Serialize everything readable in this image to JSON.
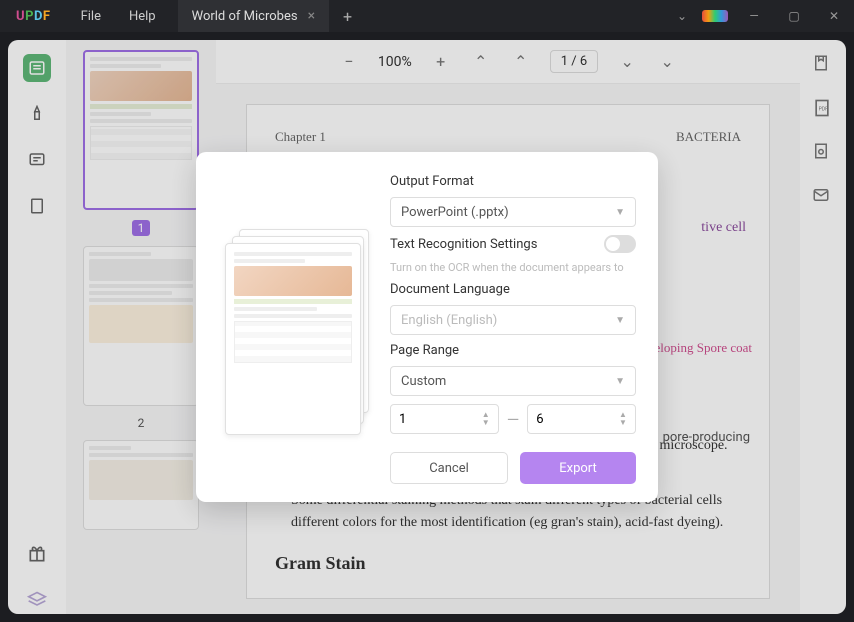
{
  "app": {
    "name": "UPDF"
  },
  "menu": {
    "file": "File",
    "help": "Help"
  },
  "tab": {
    "title": "World of Microbes"
  },
  "toolbar": {
    "zoom": "100%",
    "page_indicator": "1 / 6"
  },
  "thumbs": {
    "n1": "1",
    "n2": "2"
  },
  "page": {
    "chapter": "Chapter 1",
    "topic": "BACTERIA",
    "bullet1": "Due to their small size, bacteria appear colorless under an optical microscope. Must be dyed to see.",
    "bullet2": "Some differential staining methods that stain different types of bacterial cells different colors for the most identification (eg gran's stain), acid-fast dyeing).",
    "heading": "Gram Stain",
    "anno1": "tive cell",
    "anno2": "Developing\nSpore coat",
    "anno3": "pore-producing"
  },
  "dialog": {
    "output_format_label": "Output Format",
    "output_format_value": "PowerPoint (.pptx)",
    "ocr_label": "Text Recognition Settings",
    "ocr_hint": "Turn on the OCR when the document appears to",
    "lang_label": "Document Language",
    "lang_value": "English (English)",
    "range_label": "Page Range",
    "range_value": "Custom",
    "range_from": "1",
    "range_to": "6",
    "cancel": "Cancel",
    "export": "Export"
  }
}
